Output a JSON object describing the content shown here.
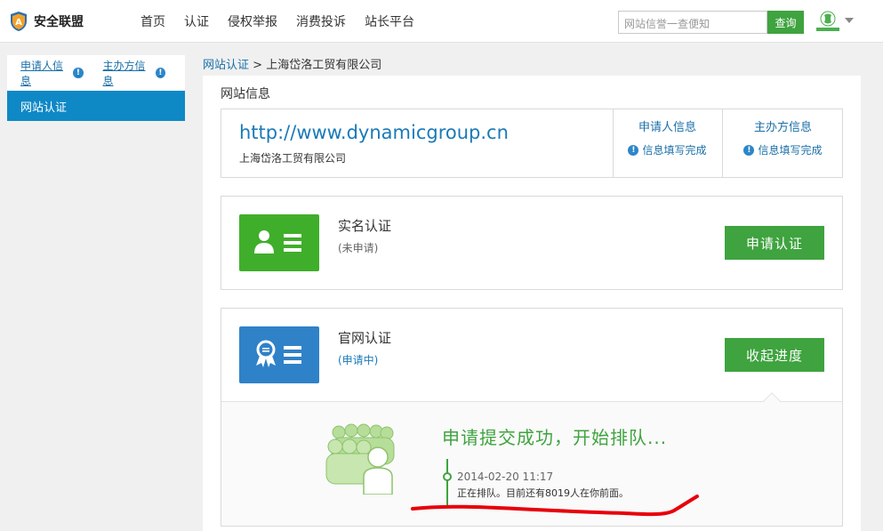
{
  "header": {
    "logo_text": "安全联盟",
    "nav": [
      "首页",
      "认证",
      "侵权举报",
      "消费投诉",
      "站长平台"
    ],
    "search_placeholder": "网站信誉一查便知",
    "search_button": "查询"
  },
  "sidebar": {
    "tabs": [
      {
        "label": "申请人信息",
        "icon": "info-icon"
      },
      {
        "label": "主办方信息",
        "icon": "info-icon"
      }
    ],
    "active_item": "网站认证"
  },
  "breadcrumb": {
    "link": "网站认证",
    "separator": ">",
    "current": "上海岱洛工贸有限公司"
  },
  "site_info": {
    "section_title": "网站信息",
    "url": "http://www.dynamicgroup.cn",
    "company": "上海岱洛工贸有限公司",
    "columns": [
      {
        "title": "申请人信息",
        "status": "信息填写完成"
      },
      {
        "title": "主办方信息",
        "status": "信息填写完成"
      }
    ]
  },
  "certifications": [
    {
      "title": "实名认证",
      "status": "(未申请)",
      "status_color": "#666666",
      "button": "申请认证",
      "icon_color": "#3fae2a",
      "icon": "person-card-icon"
    },
    {
      "title": "官网认证",
      "status": "(申请中)",
      "status_color": "#1a7ab8",
      "button": "收起进度",
      "icon_color": "#2f82c8",
      "icon": "award-card-icon"
    }
  ],
  "progress": {
    "title": "申请提交成功，开始排队...",
    "time": "2014-02-20 11:17",
    "message": "正在排队。目前还有8019人在你前面。"
  },
  "colors": {
    "accent_green": "#3fa33f",
    "link_blue": "#1a6fa8",
    "sidebar_active": "#0f88c6",
    "annotation_red": "#e8000b"
  }
}
